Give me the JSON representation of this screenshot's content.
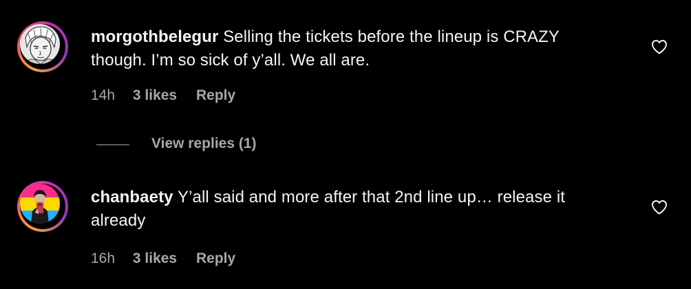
{
  "comments": [
    {
      "username": "morgothbelegur",
      "text": "Selling the tickets before the lineup is CRAZY though. I’m so sick of y’all. We all are.",
      "time": "14h",
      "likes": "3 likes",
      "reply_label": "Reply",
      "view_replies": "View replies (1)",
      "avatar_icon": "manga-character-avatar"
    },
    {
      "username": "chanbaety",
      "text": "Y’all said and more after that 2nd line up… release it already",
      "time": "16h",
      "likes": "3 likes",
      "reply_label": "Reply",
      "avatar_icon": "pansexual-flag-selfie-avatar"
    }
  ],
  "icons": {
    "like": "heart-outline-icon"
  },
  "colors": {
    "background": "#000000",
    "primary_text": "#f5f5f5",
    "secondary_text": "#a8a8a8",
    "story_ring_start": "#f9a13a",
    "story_ring_end": "#c72db3"
  }
}
